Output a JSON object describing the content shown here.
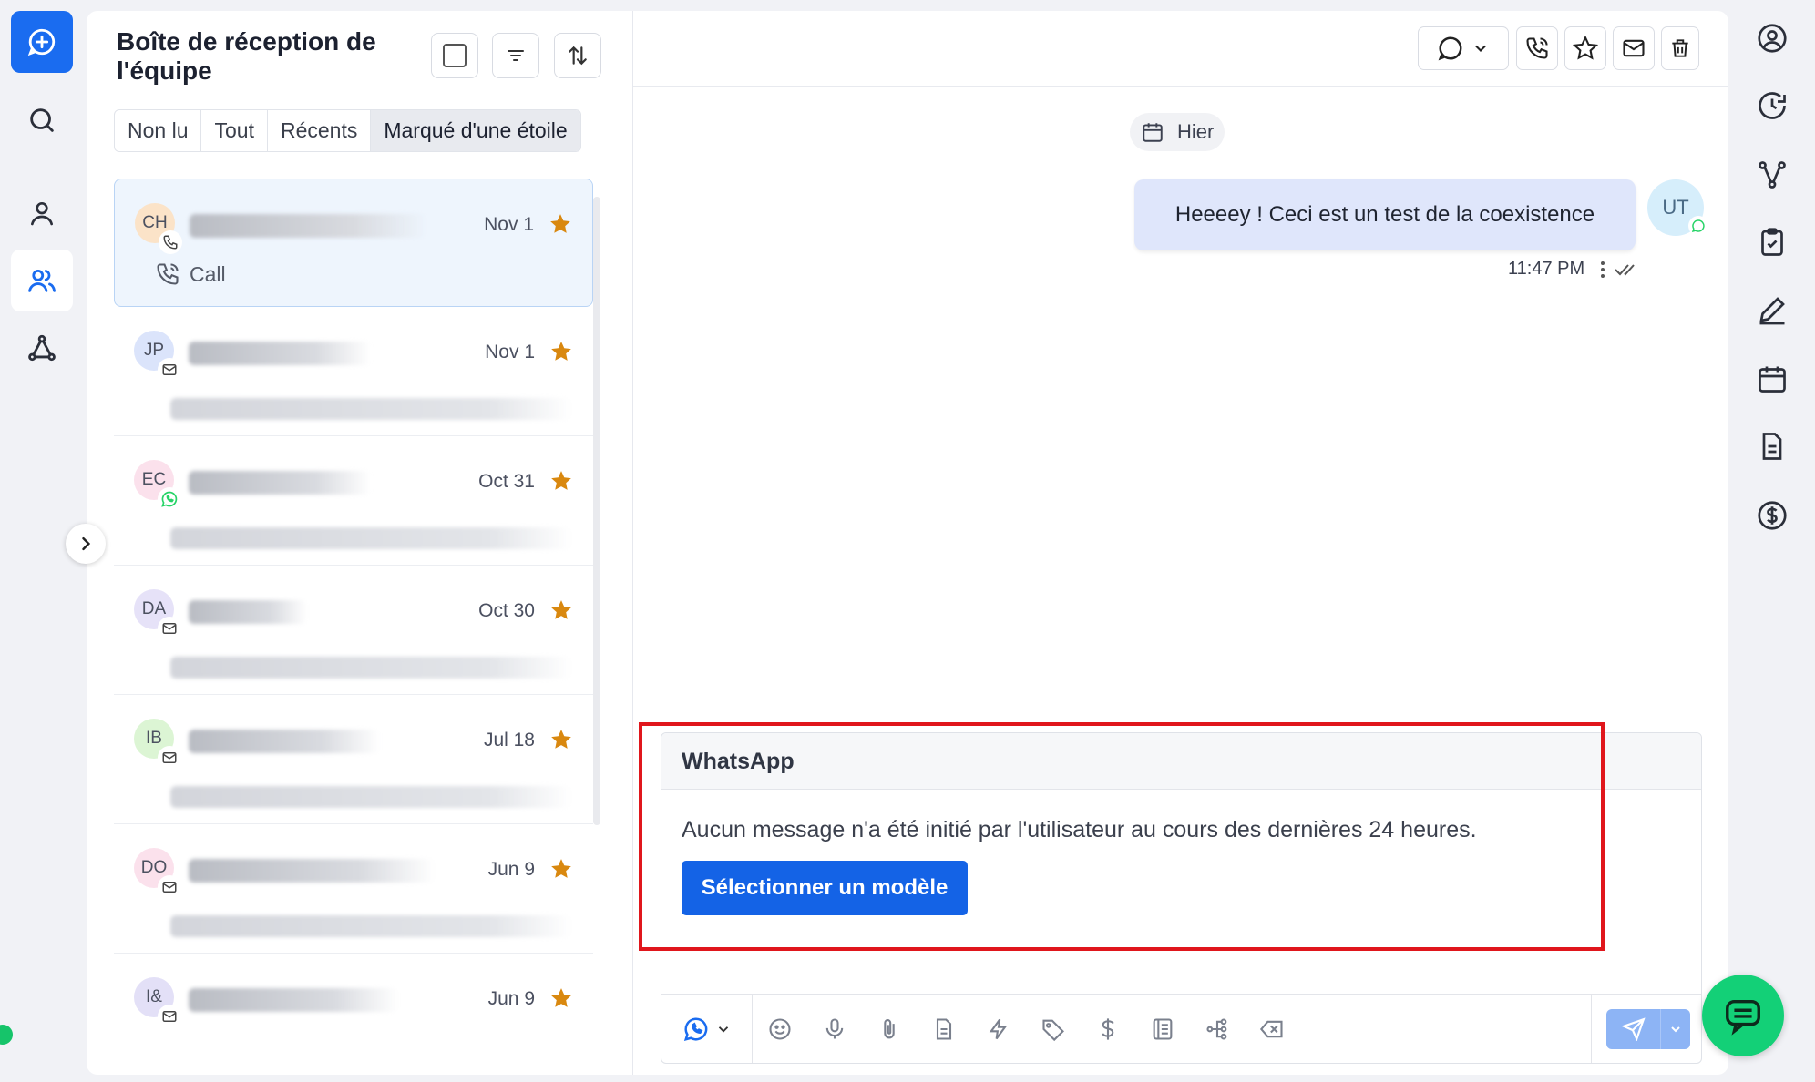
{
  "inbox": {
    "title": "Boîte de réception de l'équipe",
    "tabs": [
      "Non lu",
      "Tout",
      "Récents",
      "Marqué d'une étoile"
    ],
    "active_tab": "Marqué d'une étoile",
    "conversations": [
      {
        "initials": "CH",
        "date": "Nov 1",
        "channel": "call",
        "preview": "Call",
        "avatar_color": "#fbe3c8",
        "starred": true
      },
      {
        "initials": "JP",
        "date": "Nov 1",
        "channel": "email",
        "avatar_color": "#dbe4fb",
        "starred": true
      },
      {
        "initials": "EC",
        "date": "Oct 31",
        "channel": "whatsapp",
        "avatar_color": "#fbe1ec",
        "starred": true
      },
      {
        "initials": "DA",
        "date": "Oct 30",
        "channel": "email",
        "avatar_color": "#e6e2f8",
        "starred": true
      },
      {
        "initials": "IB",
        "date": "Jul 18",
        "channel": "email",
        "avatar_color": "#dcf5d4",
        "starred": true
      },
      {
        "initials": "DO",
        "date": "Jun 9",
        "channel": "email",
        "avatar_color": "#fbe1ec",
        "starred": true
      },
      {
        "initials": "I&",
        "date": "Jun 9",
        "channel": "email",
        "avatar_color": "#e3e0f7",
        "starred": true
      }
    ]
  },
  "chat": {
    "date_label": "Hier",
    "message": {
      "text": "Heeeey ! Ceci est un test de la coexistence",
      "time": "11:47 PM",
      "sender_initials": "UT"
    },
    "composer": {
      "channel": "WhatsApp",
      "notice": "Aucun message n'a été initié par l'utilisateur au cours des dernières 24 heures.",
      "template_button": "Sélectionner un modèle"
    }
  },
  "colors": {
    "accent": "#1a6cf0",
    "star": "#d9880f",
    "whatsapp": "#25d366",
    "highlight": "#e0161c",
    "fab": "#13d077"
  }
}
